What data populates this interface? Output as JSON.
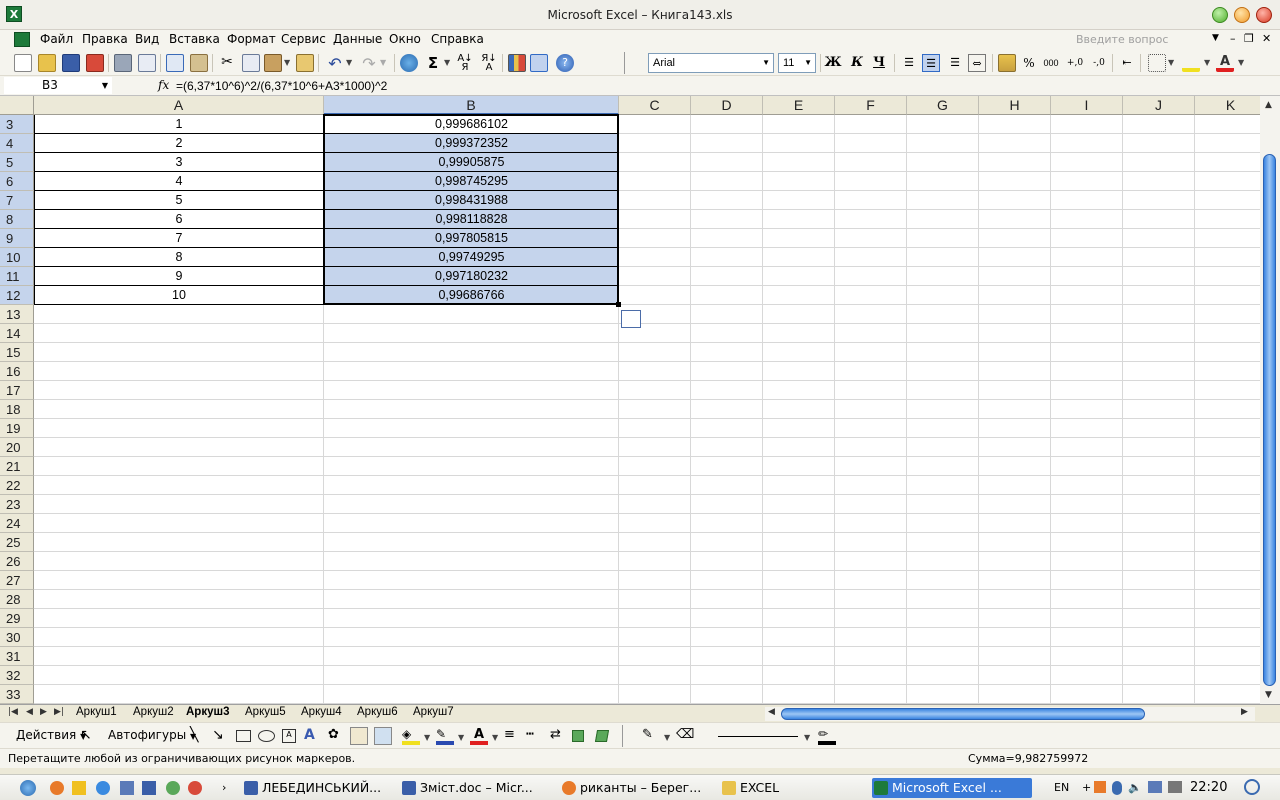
{
  "window": {
    "title": "Microsoft Excel – Книга143.xls",
    "app_icon": "X"
  },
  "menu": {
    "items": [
      "Файл",
      "Правка",
      "Вид",
      "Вставка",
      "Формат",
      "Сервис",
      "Данные",
      "Окно",
      "Справка"
    ],
    "question_placeholder": "Введите вопрос"
  },
  "toolbar": {
    "font_name": "Arial",
    "font_size": "11",
    "bold_label": "Ж",
    "italic_label": "К",
    "underline_label": "Ч",
    "percent_label": "%",
    "thousands_label": "000"
  },
  "formula_bar": {
    "cell_ref": "B3",
    "fx_label": "fx",
    "formula": "=(6,37*10^6)^2/(6,37*10^6+A3*1000)^2"
  },
  "grid": {
    "columns": [
      "A",
      "B",
      "C",
      "D",
      "E",
      "F",
      "G",
      "H",
      "I",
      "J",
      "K"
    ],
    "selected_column": "B",
    "row_numbers": [
      "3",
      "4",
      "5",
      "6",
      "7",
      "8",
      "9",
      "10",
      "11",
      "12",
      "13",
      "14",
      "15",
      "16",
      "17",
      "18",
      "19",
      "20",
      "21",
      "22",
      "23",
      "24",
      "25",
      "26",
      "27",
      "28",
      "29",
      "30",
      "31",
      "32",
      "33"
    ],
    "data_rows": [
      {
        "a": "1",
        "b": "0,999686102"
      },
      {
        "a": "2",
        "b": "0,999372352"
      },
      {
        "a": "3",
        "b": "0,99905875"
      },
      {
        "a": "4",
        "b": "0,998745295"
      },
      {
        "a": "5",
        "b": "0,998431988"
      },
      {
        "a": "6",
        "b": "0,998118828"
      },
      {
        "a": "7",
        "b": "0,997805815"
      },
      {
        "a": "8",
        "b": "0,99749295"
      },
      {
        "a": "9",
        "b": "0,997180232"
      },
      {
        "a": "10",
        "b": "0,99686766"
      }
    ],
    "selection_color": "#c5d4ec"
  },
  "sheets": {
    "tabs": [
      "Аркуш1",
      "Аркуш2",
      "Аркуш3",
      "Аркуш5",
      "Аркуш4",
      "Аркуш6",
      "Аркуш7"
    ],
    "active": "Аркуш3"
  },
  "drawing": {
    "actions_label": "Действия",
    "autoshapes_label": "Автофигуры"
  },
  "status": {
    "message": "Перетащите любой из ограничивающих рисунок маркеров.",
    "sum": "Сумма=9,982759972"
  },
  "taskbar": {
    "tasks": [
      "ЛЕБЕДИНСЬКИЙ...",
      "Зміст.doc – Micr...",
      "риканты – Берег...",
      "EXCEL",
      "Microsoft Excel ..."
    ],
    "active_task": "Microsoft Excel ...",
    "lang": "EN",
    "time": "22:20"
  }
}
